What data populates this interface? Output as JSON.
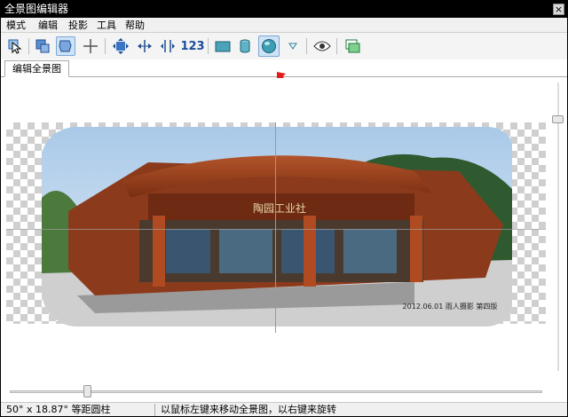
{
  "window": {
    "title": "全景图编辑器",
    "close_glyph": "×"
  },
  "menu": [
    {
      "label": "模式"
    },
    {
      "label": "编辑"
    },
    {
      "label": "投影"
    },
    {
      "label": "工具"
    },
    {
      "label": "帮助"
    }
  ],
  "toolbar": {
    "number_button_label": "123",
    "icons": [
      "select-cursor-icon",
      "rotate-layer-icon",
      "move-hand-icon",
      "crosshair-icon",
      "move-all-icon",
      "stretch-horizontal-icon",
      "stretch-icon",
      "rectilinear-icon",
      "cylinder-icon",
      "sphere-icon",
      "dropdown-arrow-icon",
      "eye-icon",
      "layers-icon"
    ]
  },
  "tabs": [
    {
      "label": "编辑全景图"
    }
  ],
  "canvas": {
    "watermark": "2012.06.01 雨人摄影 第四版",
    "sign_text": "陶园工业社",
    "vertical_zoom": 0.12,
    "horizontal_zoom": 0.14
  },
  "status": {
    "projection": "50° x 18.87° 等距圆柱",
    "hint": "以鼠标左键来移动全景图，以右键来旋转"
  },
  "colors": {
    "accent": "#1b4c9b",
    "arrow": "#e31b1b",
    "titlebar": "#000000"
  }
}
